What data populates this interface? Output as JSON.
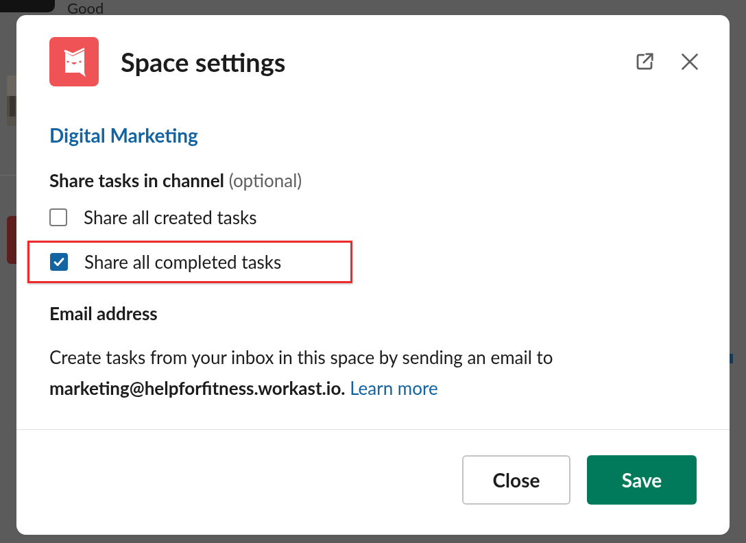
{
  "background": {
    "message_text": "Good"
  },
  "dialog": {
    "title": "Space settings",
    "space_name": "Digital Marketing",
    "share_section": {
      "label": "Share tasks in channel",
      "optional_note": "(optional)",
      "options": [
        {
          "label": "Share all created tasks",
          "checked": false,
          "highlighted": false
        },
        {
          "label": "Share all completed tasks",
          "checked": true,
          "highlighted": true
        }
      ]
    },
    "email_section": {
      "label": "Email address",
      "description": "Create tasks from your inbox in this space by sending an email to",
      "address": "marketing@helpforfitness.workast.io.",
      "link": "Learn more"
    },
    "buttons": [
      {
        "label": "Close",
        "kind": "secondary"
      },
      {
        "label": "Save",
        "kind": "primary"
      }
    ]
  }
}
